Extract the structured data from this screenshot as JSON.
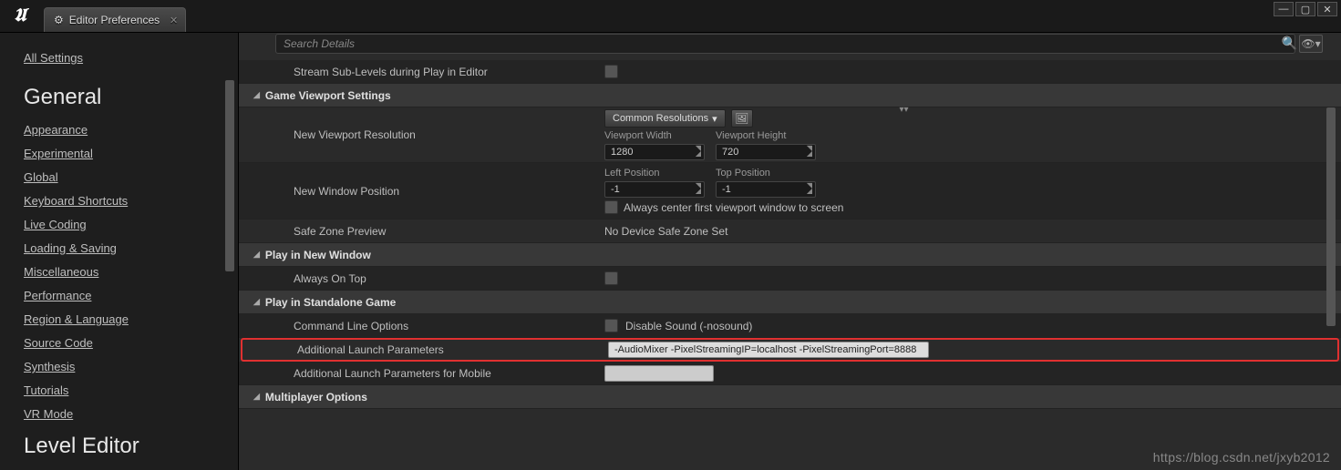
{
  "window": {
    "tab_title": "Editor Preferences"
  },
  "sidebar": {
    "all": "All Settings",
    "sections": [
      {
        "title": "General",
        "items": [
          "Appearance",
          "Experimental",
          "Global",
          "Keyboard Shortcuts",
          "Live Coding",
          "Loading & Saving",
          "Miscellaneous",
          "Performance",
          "Region & Language",
          "Source Code",
          "Synthesis",
          "Tutorials",
          "VR Mode"
        ]
      },
      {
        "title": "Level Editor",
        "items": []
      }
    ]
  },
  "search": {
    "placeholder": "Search Details"
  },
  "rows": {
    "stream_sub": "Stream Sub-Levels during Play in Editor",
    "sec_viewport": "Game Viewport Settings",
    "new_res": "New Viewport Resolution",
    "common_res": "Common Resolutions",
    "vw_label": "Viewport Width",
    "vh_label": "Viewport Height",
    "vw": "1280",
    "vh": "720",
    "new_win_pos": "New Window Position",
    "lp_label": "Left Position",
    "tp_label": "Top Position",
    "lp": "-1",
    "tp": "-1",
    "center": "Always center first viewport window to screen",
    "safe_zone": "Safe Zone Preview",
    "safe_zone_val": "No Device Safe Zone Set",
    "sec_new_window": "Play in New Window",
    "always_top": "Always On Top",
    "sec_standalone": "Play in Standalone Game",
    "cmd_line": "Command Line Options",
    "disable_sound": "Disable Sound (-nosound)",
    "add_launch": "Additional Launch Parameters",
    "add_launch_val": "-AudioMixer -PixelStreamingIP=localhost -PixelStreamingPort=8888",
    "add_launch_mobile": "Additional Launch Parameters for Mobile",
    "sec_multiplayer": "Multiplayer Options"
  },
  "watermark": "https://blog.csdn.net/jxyb2012"
}
